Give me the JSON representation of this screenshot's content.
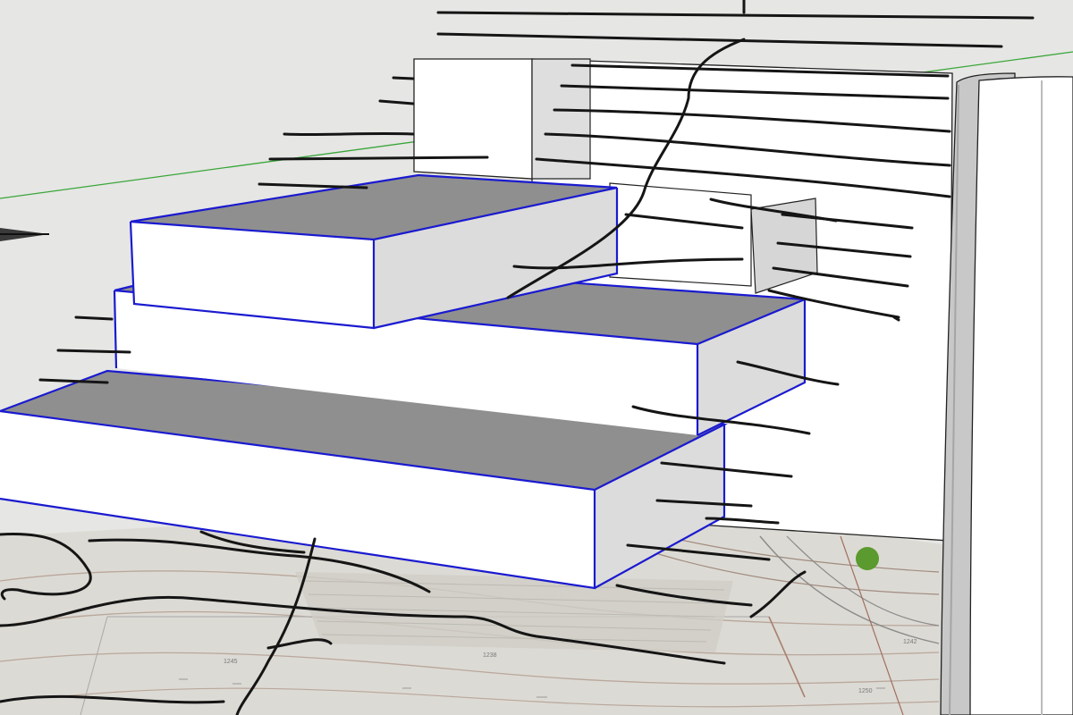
{
  "viewport": {
    "colors": {
      "background": "#e6e6e4",
      "selection_edge": "#1a1ad0",
      "top_face_selected": "#8f8f8f",
      "white_face": "#ffffff",
      "shaded_face": "#dcdcdc",
      "green_axis": "#3aa63a",
      "sketch_line": "#151515",
      "site_plan_lines": "#9a8a80",
      "tree_marker": "#5a9a2e"
    }
  },
  "site_plan": {
    "labels": [
      "1238",
      "1242",
      "1245",
      "1250"
    ]
  }
}
